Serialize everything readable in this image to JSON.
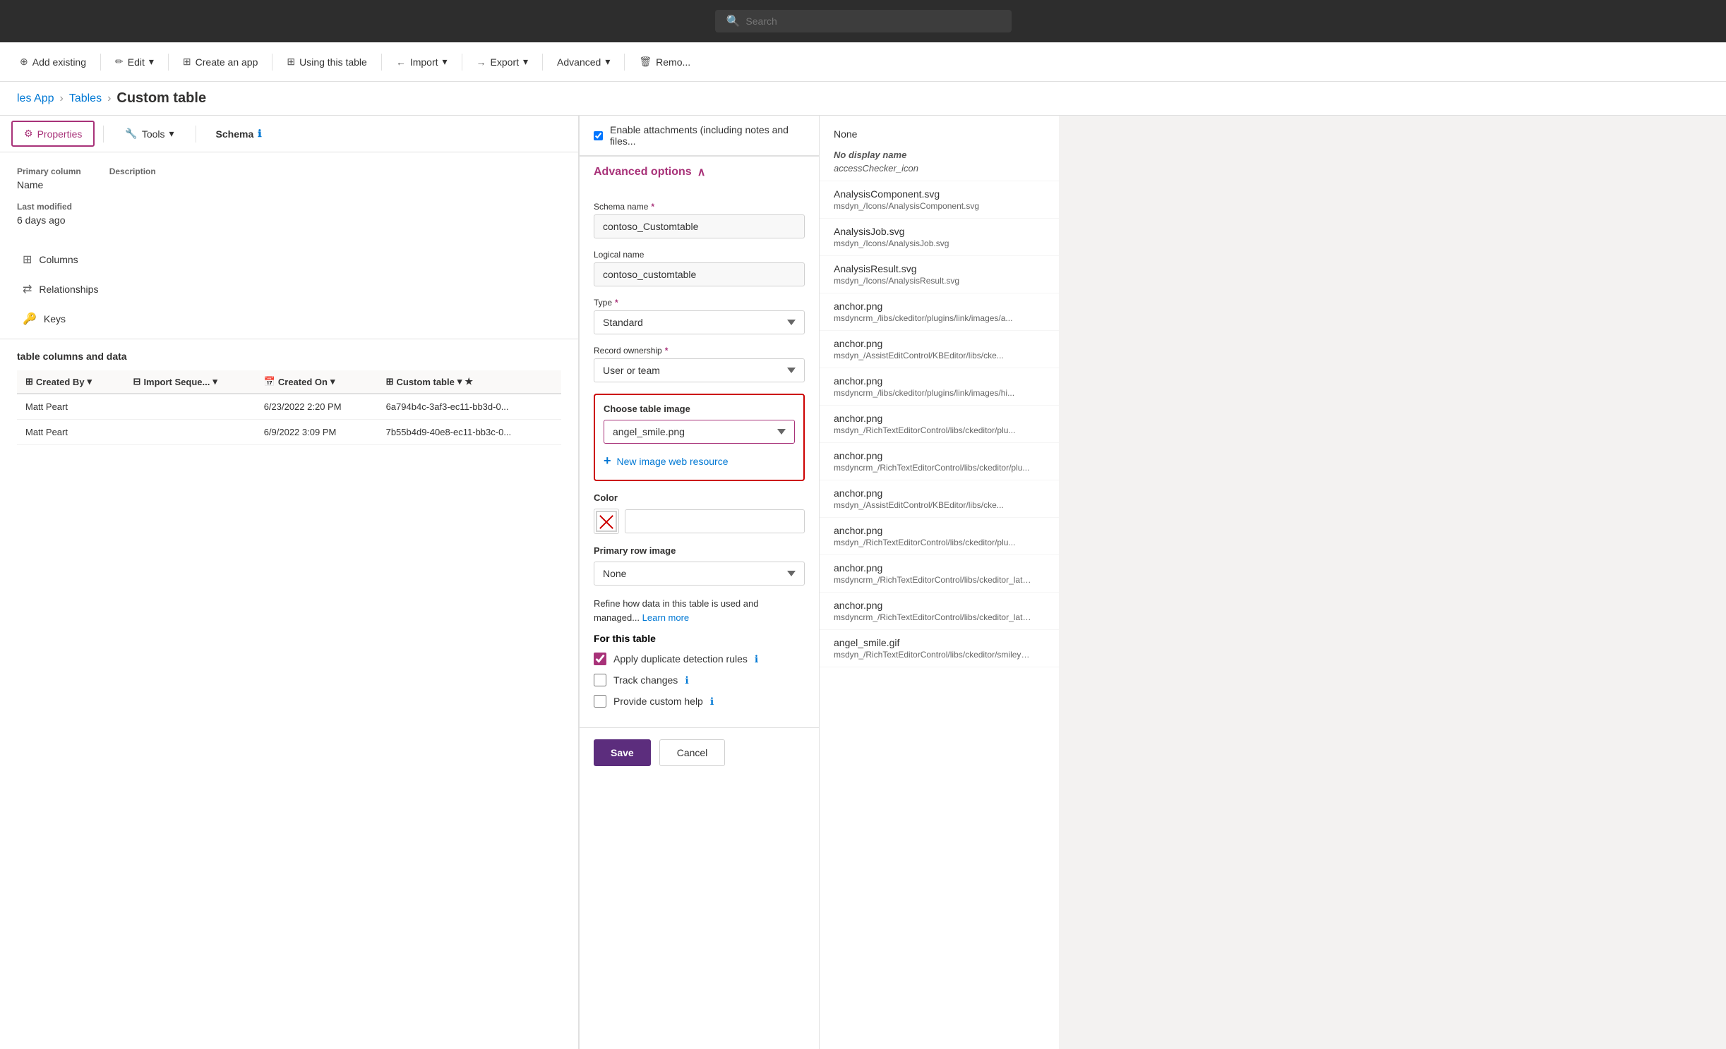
{
  "topbar": {
    "search_placeholder": "Search"
  },
  "toolbar": {
    "add_existing": "Add existing",
    "edit": "Edit",
    "create_app": "Create an app",
    "using_table": "Using this table",
    "import": "Import",
    "export": "Export",
    "advanced": "Advanced",
    "remove": "Remo..."
  },
  "breadcrumb": {
    "app": "les App",
    "tables": "Tables",
    "current": "Custom table"
  },
  "subtabs": {
    "properties_label": "Properties",
    "tools_label": "Tools",
    "schema_label": "Schema"
  },
  "table_info": {
    "primary_col_label": "Primary column",
    "primary_col_value": "Name",
    "description_label": "Description",
    "last_modified_label": "Last modified",
    "last_modified_value": "6 days ago"
  },
  "schema_nav": {
    "columns": "Columns",
    "relationships": "Relationships",
    "keys": "Keys"
  },
  "data_section": {
    "title": "table columns and data",
    "columns": {
      "created_by": "Created By",
      "import_seq": "Import Seque...",
      "created_on": "Created On",
      "custom_table": "Custom table"
    },
    "rows": [
      {
        "created_by": "Matt Peart",
        "import_seq": "",
        "created_on": "6/23/2022 2:20 PM",
        "custom_table": "6a794b4c-3af3-ec11-bb3d-0..."
      },
      {
        "created_by": "Matt Peart",
        "import_seq": "",
        "created_on": "6/9/2022 3:09 PM",
        "custom_table": "7b55b4d9-40e8-ec11-bb3c-0..."
      }
    ]
  },
  "properties_panel": {
    "enable_attachments_label": "Enable attachments (including notes and files...",
    "advanced_options_label": "Advanced options",
    "schema_name_label": "Schema name",
    "schema_name_required": true,
    "schema_name_value": "contoso_Customtable",
    "logical_name_label": "Logical name",
    "logical_name_value": "contoso_customtable",
    "type_label": "Type",
    "type_required": true,
    "type_value": "Standard",
    "record_ownership_label": "Record ownership",
    "record_ownership_required": true,
    "record_ownership_value": "User or team",
    "choose_image_label": "Choose table image",
    "chosen_image": "angel_smile.png",
    "new_image_btn": "New image web resource",
    "color_label": "Color",
    "primary_row_image_label": "Primary row image",
    "primary_row_image_value": "None",
    "refine_text": "Refine how data in this table is used and managed...",
    "learn_more": "Learn more",
    "for_this_table": "For this table",
    "apply_duplicate": "Apply duplicate detection rules",
    "track_changes": "Track changes",
    "provide_custom_help": "Provide custom help",
    "save_btn": "Save",
    "cancel_btn": "Cancel"
  },
  "dropdown_list": {
    "none_label": "None",
    "no_display_name": "No display name",
    "no_display_sub": "accessChecker_icon",
    "items": [
      {
        "name": "AnalysisComponent.svg",
        "sub": "msdyn_/Icons/AnalysisComponent.svg"
      },
      {
        "name": "AnalysisJob.svg",
        "sub": "msdyn_/Icons/AnalysisJob.svg"
      },
      {
        "name": "AnalysisResult.svg",
        "sub": "msdyn_/Icons/AnalysisResult.svg"
      },
      {
        "name": "anchor.png",
        "sub": "msdyncrm_/libs/ckeditor/plugins/link/images/a..."
      },
      {
        "name": "anchor.png",
        "sub": "msdyn_/AssistEditControl/KBEditor/libs/cke..."
      },
      {
        "name": "anchor.png",
        "sub": "msdyncrm_/libs/ckeditor/plugins/link/images/hi..."
      },
      {
        "name": "anchor.png",
        "sub": "msdyn_/RichTextEditorControl/libs/ckeditor/plu..."
      },
      {
        "name": "anchor.png",
        "sub": "msdyncrm_/RichTextEditorControl/libs/ckeditor/plu..."
      },
      {
        "name": "anchor.png",
        "sub": "msdyn_/AssistEditControl/KBEditor/libs/cke..."
      },
      {
        "name": "anchor.png",
        "sub": "msdyn_/RichTextEditorControl/libs/ckeditor/plu..."
      },
      {
        "name": "anchor.png",
        "sub": "msdyncrm_/RichTextEditorControl/libs/ckeditor_late..."
      },
      {
        "name": "anchor.png",
        "sub": "msdyncrm_/RichTextEditorControl/libs/ckeditor_late..."
      },
      {
        "name": "angel_smile.gif",
        "sub": "msdyn_/RichTextEditorControl/libs/ckeditor/smiley/images..."
      }
    ]
  }
}
